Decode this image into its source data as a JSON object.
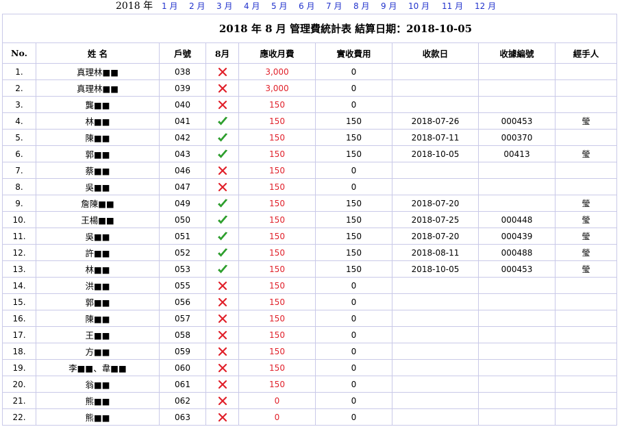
{
  "nav": {
    "year": "2018 年",
    "months": [
      "1 月",
      "2 月",
      "3 月",
      "4 月",
      "5 月",
      "6 月",
      "7 月",
      "8 月",
      "9 月",
      "10 月",
      "11 月",
      "12 月"
    ]
  },
  "table": {
    "title": "2018 年 8 月 管理費統計表  結算日期：2018-10-05",
    "headers": [
      "No.",
      "姓 名",
      "戶號",
      "8月",
      "應收月費",
      "實收費用",
      "收款日",
      "收據編號",
      "經手人"
    ],
    "colors": {
      "grid": "#c9c9e8",
      "link": "#2233cc",
      "due": "#e0202a",
      "paid_mark": "#2fa82f",
      "unpaid_mark": "#e0202a"
    },
    "rows": [
      {
        "no": "1.",
        "name": "真理林■■",
        "unit": "038",
        "paid": false,
        "due": "3,000",
        "received": "0",
        "date": "",
        "receipt": "",
        "handler": ""
      },
      {
        "no": "2.",
        "name": "真理林■■",
        "unit": "039",
        "paid": false,
        "due": "3,000",
        "received": "0",
        "date": "",
        "receipt": "",
        "handler": ""
      },
      {
        "no": "3.",
        "name": "龔■■",
        "unit": "040",
        "paid": false,
        "due": "150",
        "received": "0",
        "date": "",
        "receipt": "",
        "handler": ""
      },
      {
        "no": "4.",
        "name": "林■■",
        "unit": "041",
        "paid": true,
        "due": "150",
        "received": "150",
        "date": "2018-07-26",
        "receipt": "000453",
        "handler": "瑩"
      },
      {
        "no": "5.",
        "name": "陳■■",
        "unit": "042",
        "paid": true,
        "due": "150",
        "received": "150",
        "date": "2018-07-11",
        "receipt": "000370",
        "handler": ""
      },
      {
        "no": "6.",
        "name": "郭■■",
        "unit": "043",
        "paid": true,
        "due": "150",
        "received": "150",
        "date": "2018-10-05",
        "receipt": "00413",
        "handler": "瑩"
      },
      {
        "no": "7.",
        "name": "蔡■■",
        "unit": "046",
        "paid": false,
        "due": "150",
        "received": "0",
        "date": "",
        "receipt": "",
        "handler": ""
      },
      {
        "no": "8.",
        "name": "吳■■",
        "unit": "047",
        "paid": false,
        "due": "150",
        "received": "0",
        "date": "",
        "receipt": "",
        "handler": ""
      },
      {
        "no": "9.",
        "name": "詹陳■■",
        "unit": "049",
        "paid": true,
        "due": "150",
        "received": "150",
        "date": "2018-07-20",
        "receipt": "",
        "handler": "瑩"
      },
      {
        "no": "10.",
        "name": "王楊■■",
        "unit": "050",
        "paid": true,
        "due": "150",
        "received": "150",
        "date": "2018-07-25",
        "receipt": "000448",
        "handler": "瑩"
      },
      {
        "no": "11.",
        "name": "吳■■",
        "unit": "051",
        "paid": true,
        "due": "150",
        "received": "150",
        "date": "2018-07-20",
        "receipt": "000439",
        "handler": "瑩"
      },
      {
        "no": "12.",
        "name": "許■■",
        "unit": "052",
        "paid": true,
        "due": "150",
        "received": "150",
        "date": "2018-08-11",
        "receipt": "000488",
        "handler": "瑩"
      },
      {
        "no": "13.",
        "name": "林■■",
        "unit": "053",
        "paid": true,
        "due": "150",
        "received": "150",
        "date": "2018-10-05",
        "receipt": "000453",
        "handler": "瑩"
      },
      {
        "no": "14.",
        "name": "洪■■",
        "unit": "055",
        "paid": false,
        "due": "150",
        "received": "0",
        "date": "",
        "receipt": "",
        "handler": ""
      },
      {
        "no": "15.",
        "name": "郭■■",
        "unit": "056",
        "paid": false,
        "due": "150",
        "received": "0",
        "date": "",
        "receipt": "",
        "handler": ""
      },
      {
        "no": "16.",
        "name": "陳■■",
        "unit": "057",
        "paid": false,
        "due": "150",
        "received": "0",
        "date": "",
        "receipt": "",
        "handler": ""
      },
      {
        "no": "17.",
        "name": "王■■",
        "unit": "058",
        "paid": false,
        "due": "150",
        "received": "0",
        "date": "",
        "receipt": "",
        "handler": ""
      },
      {
        "no": "18.",
        "name": "方■■",
        "unit": "059",
        "paid": false,
        "due": "150",
        "received": "0",
        "date": "",
        "receipt": "",
        "handler": ""
      },
      {
        "no": "19.",
        "name": "李■■、韋■■",
        "unit": "060",
        "paid": false,
        "due": "150",
        "received": "0",
        "date": "",
        "receipt": "",
        "handler": ""
      },
      {
        "no": "20.",
        "name": "翁■■",
        "unit": "061",
        "paid": false,
        "due": "150",
        "received": "0",
        "date": "",
        "receipt": "",
        "handler": ""
      },
      {
        "no": "21.",
        "name": "熊■■",
        "unit": "062",
        "paid": false,
        "due": "0",
        "received": "0",
        "date": "",
        "receipt": "",
        "handler": ""
      },
      {
        "no": "22.",
        "name": "熊■■",
        "unit": "063",
        "paid": false,
        "due": "0",
        "received": "0",
        "date": "",
        "receipt": "",
        "handler": ""
      }
    ]
  }
}
